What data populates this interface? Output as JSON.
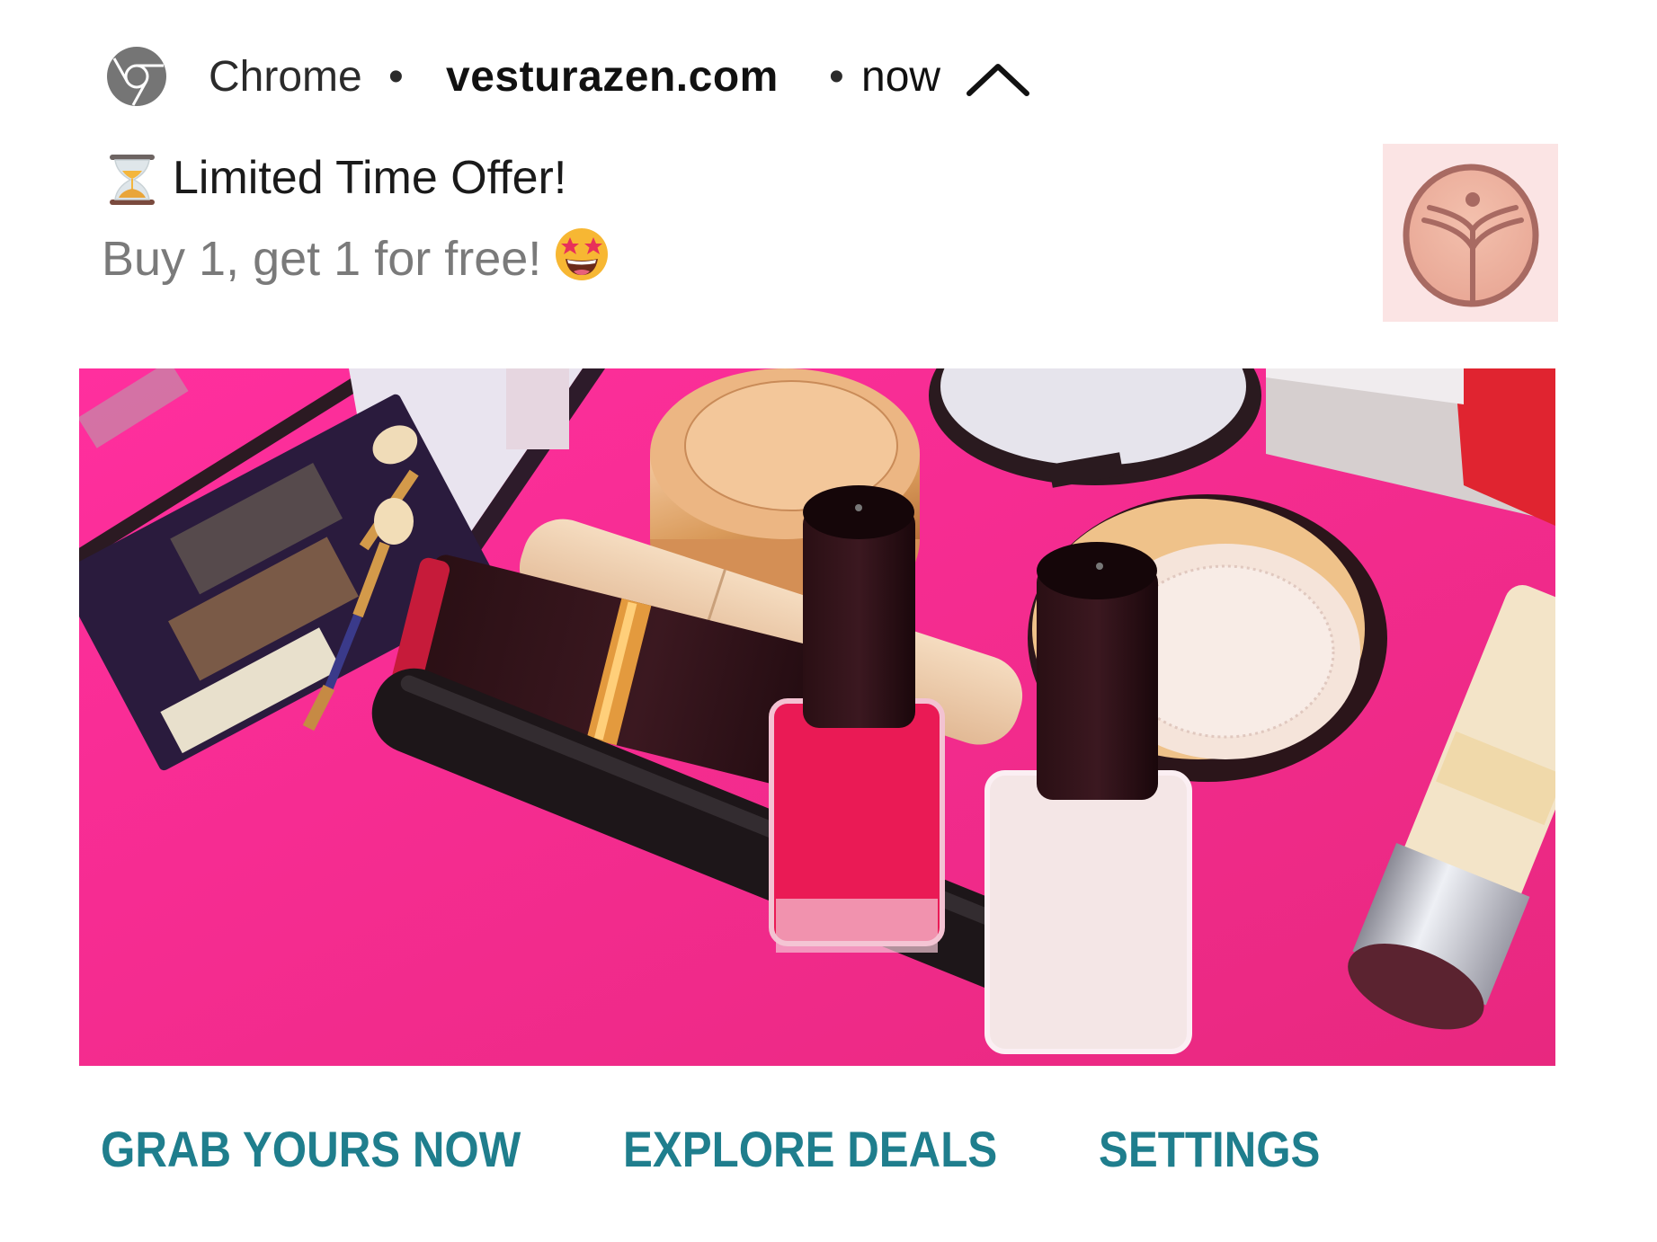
{
  "notification": {
    "app_name": "Chrome",
    "separator": "•",
    "site": "vesturazen.com",
    "time": "now",
    "title": "Limited Time Offer!",
    "title_emoji": "hourglass",
    "body": "Buy 1, get 1 for free!",
    "body_emoji": "star-struck",
    "large_icon": "brand-logo-tree",
    "image": "cosmetics-product-flatlay"
  },
  "icons": {
    "app": "chrome-icon",
    "expand": "chevron-up-icon"
  },
  "actions": [
    {
      "label": "GRAB YOURS NOW"
    },
    {
      "label": "EXPLORE DEALS"
    },
    {
      "label": "SETTINGS"
    }
  ],
  "colors": {
    "action_text": "#1f7e8d",
    "title_text": "#1a1a1a",
    "body_text": "#7a7a7a",
    "hero_background": "#f02a91",
    "logo_background": "#fbe4e4",
    "logo_mark": "#a86a62"
  }
}
